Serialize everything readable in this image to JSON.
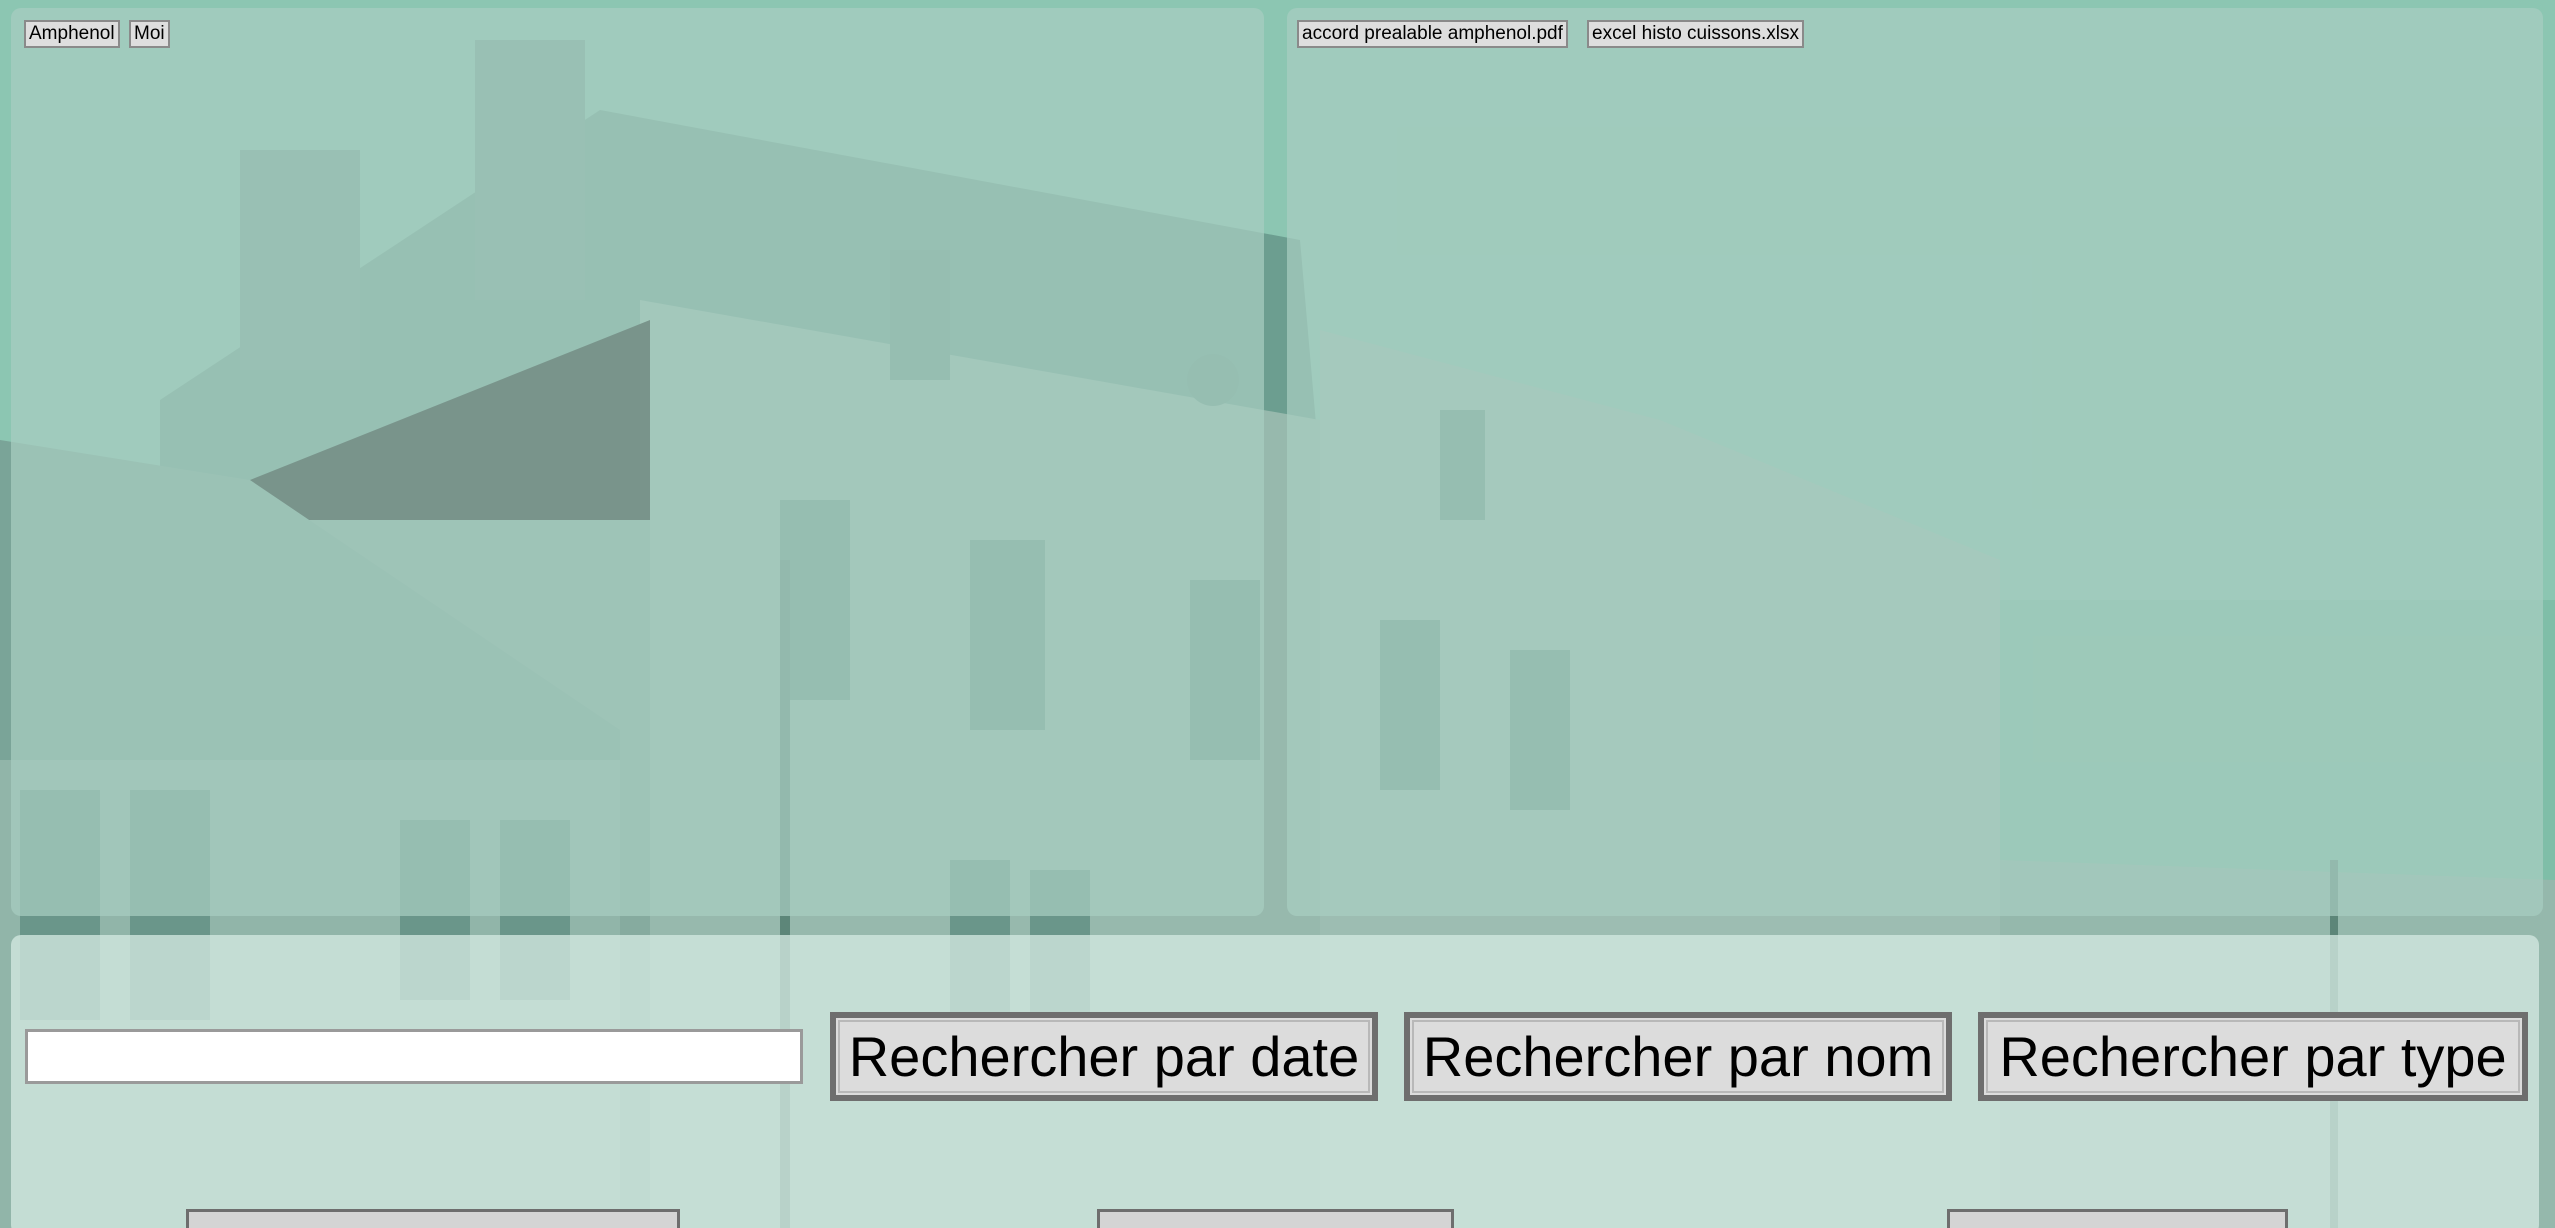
{
  "left_panel": {
    "chips": [
      {
        "label": "Amphenol"
      },
      {
        "label": "Moi"
      }
    ]
  },
  "right_panel": {
    "files": [
      {
        "label": "accord prealable amphenol.pdf"
      },
      {
        "label": "excel histo cuissons.xlsx"
      }
    ]
  },
  "search": {
    "value": "",
    "placeholder": "",
    "buttons": {
      "date": "Rechercher par date",
      "nom": "Rechercher par nom",
      "type": "Rechercher par type"
    }
  },
  "colors": {
    "accent": "#62c6a0",
    "panel_tint": "#a8cdc0",
    "button_bg": "#dcdcdc",
    "button_border": "#6e6e6e"
  }
}
